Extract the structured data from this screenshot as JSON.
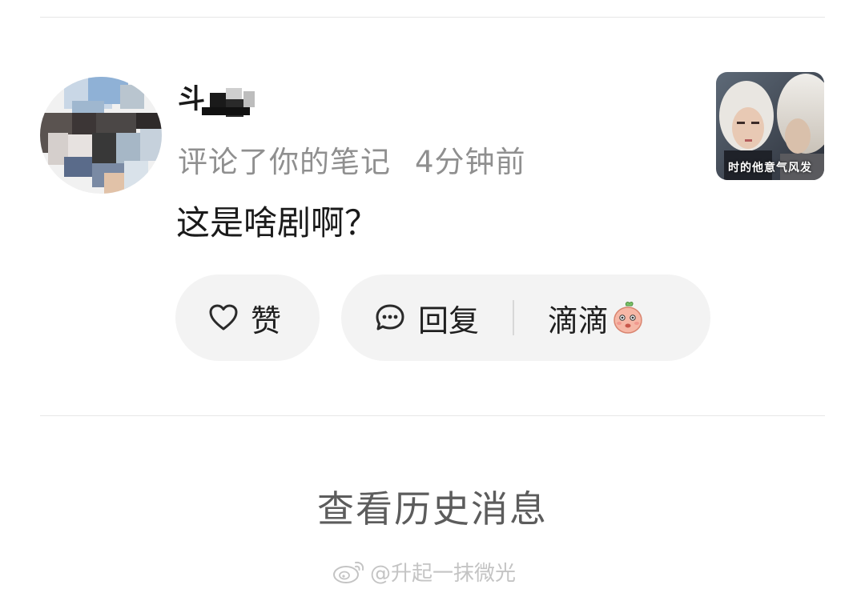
{
  "notification": {
    "username": "斗",
    "action": "评论了你的笔记",
    "time": "4分钟前",
    "comment": "这是啥剧啊？",
    "note_thumbnail_caption": "时的他意气风发"
  },
  "actions": {
    "like_label": "赞",
    "reply_label": "回复",
    "quick_reply_emoji_text": "滴滴"
  },
  "footer": {
    "history_link": "查看历史消息"
  },
  "watermark": {
    "text": "@升起一抹微光"
  },
  "icons": {
    "like": "heart-outline-icon",
    "reply": "chat-bubble-icon",
    "emoji": "peach-sticker-icon",
    "watermark_logo": "weibo-logo-icon"
  },
  "colors": {
    "meta_gray": "#8f8f8f",
    "pill_bg": "#f3f3f3",
    "history_text": "#5c5c5c"
  }
}
